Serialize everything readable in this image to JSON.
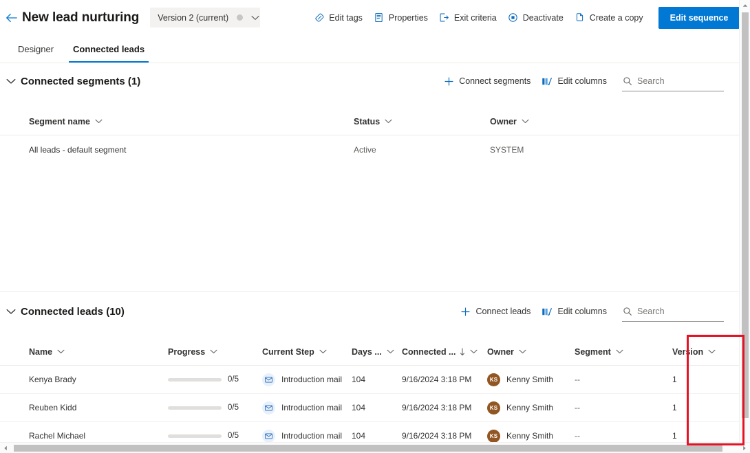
{
  "header": {
    "back_icon": "arrow-left-icon",
    "title": "New lead nurturing",
    "version_selector": {
      "label": "Version 2 (current)",
      "chevron_icon": "chevron-down-icon"
    },
    "actions": [
      {
        "label": "Edit tags",
        "icon": "tag-icon"
      },
      {
        "label": "Properties",
        "icon": "document-properties-icon"
      },
      {
        "label": "Exit criteria",
        "icon": "exit-icon"
      },
      {
        "label": "Deactivate",
        "icon": "stop-circle-icon"
      },
      {
        "label": "Create a copy",
        "icon": "copy-icon"
      }
    ],
    "primary_action": {
      "label": "Edit sequence"
    }
  },
  "tabs": [
    {
      "label": "Designer",
      "active": false
    },
    {
      "label": "Connected leads",
      "active": true
    }
  ],
  "segments_section": {
    "title": "Connected segments (1)",
    "collapse_icon": "chevron-down-icon",
    "toolbar": {
      "connect": {
        "label": "Connect segments",
        "icon": "plus-icon"
      },
      "edit_columns": {
        "label": "Edit columns",
        "icon": "columns-icon"
      },
      "search": {
        "placeholder": "Search",
        "value": "",
        "icon": "search-icon"
      }
    },
    "columns": [
      {
        "label": "Segment name",
        "sort_icon": "chevron-down-icon"
      },
      {
        "label": "Status",
        "sort_icon": "chevron-down-icon"
      },
      {
        "label": "Owner",
        "sort_icon": "chevron-down-icon"
      }
    ],
    "rows": [
      {
        "name": "All leads - default segment",
        "status": "Active",
        "owner": "SYSTEM"
      }
    ]
  },
  "leads_section": {
    "title": "Connected leads (10)",
    "collapse_icon": "chevron-down-icon",
    "toolbar": {
      "connect": {
        "label": "Connect leads",
        "icon": "plus-icon"
      },
      "edit_columns": {
        "label": "Edit columns",
        "icon": "columns-icon"
      },
      "search": {
        "placeholder": "Search",
        "value": "",
        "icon": "search-icon"
      }
    },
    "columns": [
      {
        "label": "Name",
        "sort_icon": "chevron-down-icon",
        "sorted": false
      },
      {
        "label": "Progress",
        "sort_icon": "chevron-down-icon",
        "sorted": false
      },
      {
        "label": "Current Step",
        "sort_icon": "chevron-down-icon",
        "sorted": false
      },
      {
        "label": "Days ...",
        "sort_icon": "chevron-down-icon",
        "sorted": false
      },
      {
        "label": "Connected ...",
        "sort_icon": "chevron-down-icon",
        "sorted": true,
        "sort_direction": "descending"
      },
      {
        "label": "Owner",
        "sort_icon": "chevron-down-icon",
        "sorted": false
      },
      {
        "label": "Segment",
        "sort_icon": "chevron-down-icon",
        "sorted": false
      },
      {
        "label": "Version",
        "sort_icon": "chevron-down-icon",
        "sorted": false
      }
    ],
    "rows": [
      {
        "name": "Kenya Brady",
        "progress_text": "0/5",
        "progress_value": 0,
        "current_step": "Introduction mail",
        "current_step_icon": "mail-icon",
        "days": "104",
        "connected": "9/16/2024 3:18 PM",
        "owner": "Kenny Smith",
        "owner_initials": "KS",
        "segment": "--",
        "version": "1"
      },
      {
        "name": "Reuben Kidd",
        "progress_text": "0/5",
        "progress_value": 0,
        "current_step": "Introduction mail",
        "current_step_icon": "mail-icon",
        "days": "104",
        "connected": "9/16/2024 3:18 PM",
        "owner": "Kenny Smith",
        "owner_initials": "KS",
        "segment": "--",
        "version": "1"
      },
      {
        "name": "Rachel Michael",
        "progress_text": "0/5",
        "progress_value": 0,
        "current_step": "Introduction mail",
        "current_step_icon": "mail-icon",
        "days": "104",
        "connected": "9/16/2024 3:18 PM",
        "owner": "Kenny Smith",
        "owner_initials": "KS",
        "segment": "--",
        "version": "1"
      }
    ]
  },
  "annotation": {
    "highlight_color": "#e81123",
    "target_column": "Version"
  },
  "colors": {
    "accent": "#0078d4",
    "avatar": "#925622",
    "highlight": "#e81123"
  }
}
